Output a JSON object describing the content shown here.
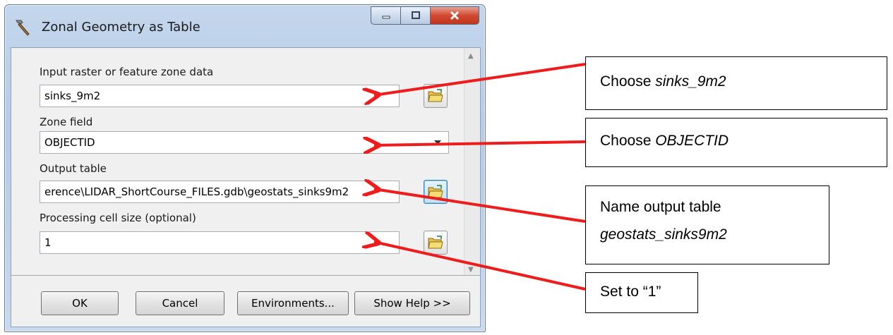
{
  "window": {
    "title": "Zonal Geometry as Table",
    "icons": [
      "hammer-icon",
      "minimize-icon",
      "maximize-icon",
      "close-icon"
    ]
  },
  "form": {
    "input_label": "Input raster or feature zone data",
    "input_value": "sinks_9m2",
    "zone_label": "Zone field",
    "zone_value": "OBJECTID",
    "output_label": "Output table",
    "output_value": "erence\\LIDAR_ShortCourse_FILES.gdb\\geostats_sinks9m2",
    "cell_label": "Processing cell size (optional)",
    "cell_value": "1"
  },
  "buttons": {
    "ok": "OK",
    "cancel": "Cancel",
    "environments": "Environments...",
    "help": "Show Help >>"
  },
  "callouts": {
    "c1_prefix": "Choose ",
    "c1_italic": "sinks_9m2",
    "c2_prefix": "Choose ",
    "c2_italic": "OBJECTID",
    "c3_line1": "Name output table",
    "c3_italic": "geostats_sinks9m2",
    "c4_text": "Set to “1”"
  },
  "colors": {
    "arrow": "#ee1c1c",
    "window_frame": "#b5cbe6",
    "close_button": "#c9452c"
  }
}
